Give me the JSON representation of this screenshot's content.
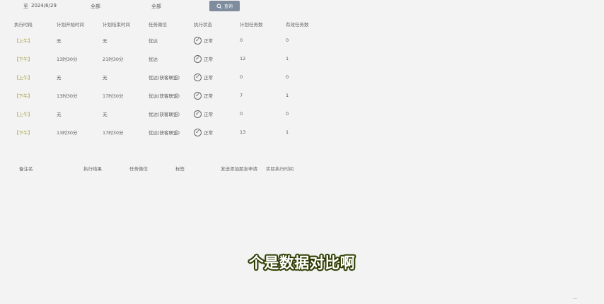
{
  "filters": {
    "date_prefix": "至",
    "date_value": "2024/6/29",
    "select1_value": "全部",
    "select2_value": "全部",
    "query_label": "查询"
  },
  "task_table": {
    "columns": [
      "执行时段",
      "计划开始时间",
      "计划结束时间",
      "任务微信",
      "执行状态",
      "计划任务数",
      "有效任务数"
    ],
    "rows": [
      {
        "period": "【上午】",
        "start": "无",
        "end": "无",
        "wechat": "优达",
        "status": "正常",
        "planned": "0",
        "valid": "0"
      },
      {
        "period": "【下午】",
        "start": "13时30分",
        "end": "21时30分",
        "wechat": "优达",
        "status": "正常",
        "planned": "12",
        "valid": "1"
      },
      {
        "period": "【上午】",
        "start": "无",
        "end": "无",
        "wechat": "优达(获客联盟)",
        "status": "正常",
        "planned": "0",
        "valid": "0"
      },
      {
        "period": "【下午】",
        "start": "13时30分",
        "end": "17时30分",
        "wechat": "优达(获客联盟)",
        "status": "正常",
        "planned": "7",
        "valid": "1"
      },
      {
        "period": "【上午】",
        "start": "无",
        "end": "无",
        "wechat": "优达(获客联盟)",
        "status": "正常",
        "planned": "0",
        "valid": "0"
      },
      {
        "period": "【下午】",
        "start": "13时30分",
        "end": "17时30分",
        "wechat": "优达(获客联盟)",
        "status": "正常",
        "planned": "13",
        "valid": "1"
      }
    ]
  },
  "detail_table": {
    "columns": [
      "备注名",
      "执行结果",
      "任务微信",
      "标签",
      "发送添加朋友申请",
      "实际执行时间"
    ]
  },
  "subtitle": "个是数据对比啊",
  "icons": {
    "query": "search-icon",
    "status": "check-circle-icon"
  },
  "colors": {
    "query_button": "#7e8c9e",
    "background": "#f3f3f3",
    "subtitle_outline": "#2b3a00"
  }
}
